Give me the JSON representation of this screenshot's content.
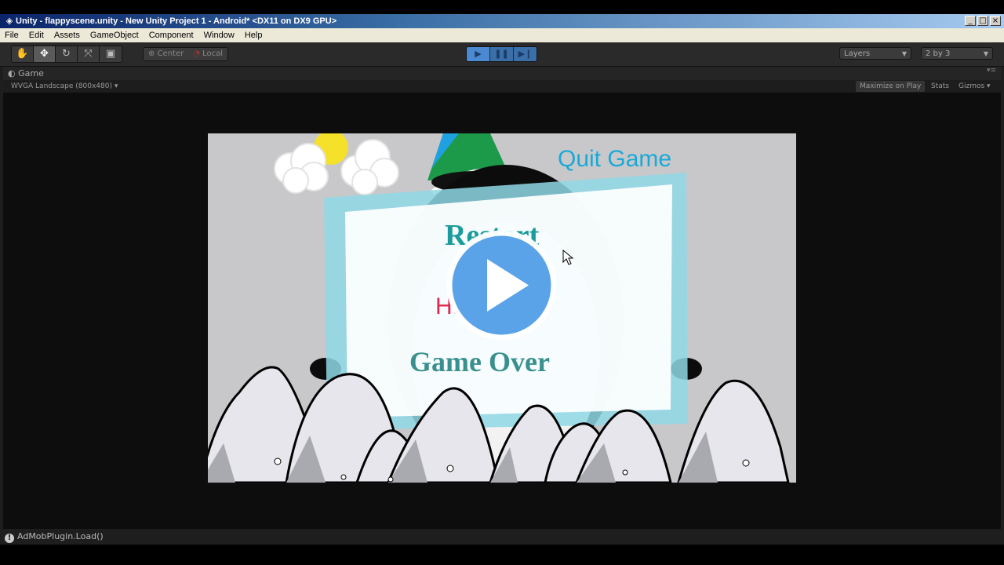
{
  "window": {
    "title": "Unity - flappyscene.unity - New Unity Project 1 - Android* <DX11 on DX9 GPU>",
    "controls": [
      "_",
      "□",
      "×"
    ]
  },
  "menu": [
    "File",
    "Edit",
    "Assets",
    "GameObject",
    "Component",
    "Window",
    "Help"
  ],
  "toolbar": {
    "transform_tools": [
      "hand-icon",
      "move-icon",
      "rotate-icon",
      "scale-icon",
      "rect-icon"
    ],
    "pivot_center": "Center",
    "pivot_local": "Local",
    "play_controls": [
      "play-icon",
      "pause-icon",
      "step-icon"
    ],
    "layers": "Layers",
    "layout": "2 by 3"
  },
  "game_tab": {
    "label": "Game",
    "aspect": "WVGA Landscape (800x480)",
    "maximize_on_play": "Maximize on Play",
    "stats": "Stats",
    "gizmos": "Gizmos"
  },
  "scene": {
    "quit": "Quit Game",
    "restart": "Restart",
    "highscore": "H...9",
    "game_over": "Game Over"
  },
  "console": {
    "message": "AdMobPlugin.Load()"
  },
  "colors": {
    "accent_blue": "#4a90d9",
    "play_button": "#5aa3e8",
    "quit_text": "#1aa9d6",
    "restart_text": "#1a9c9c",
    "highscore_text": "#e0284f",
    "game_over_text": "#3a8f8f",
    "panel_border": "#8fd8e6",
    "sky": "#c8c8ca"
  }
}
